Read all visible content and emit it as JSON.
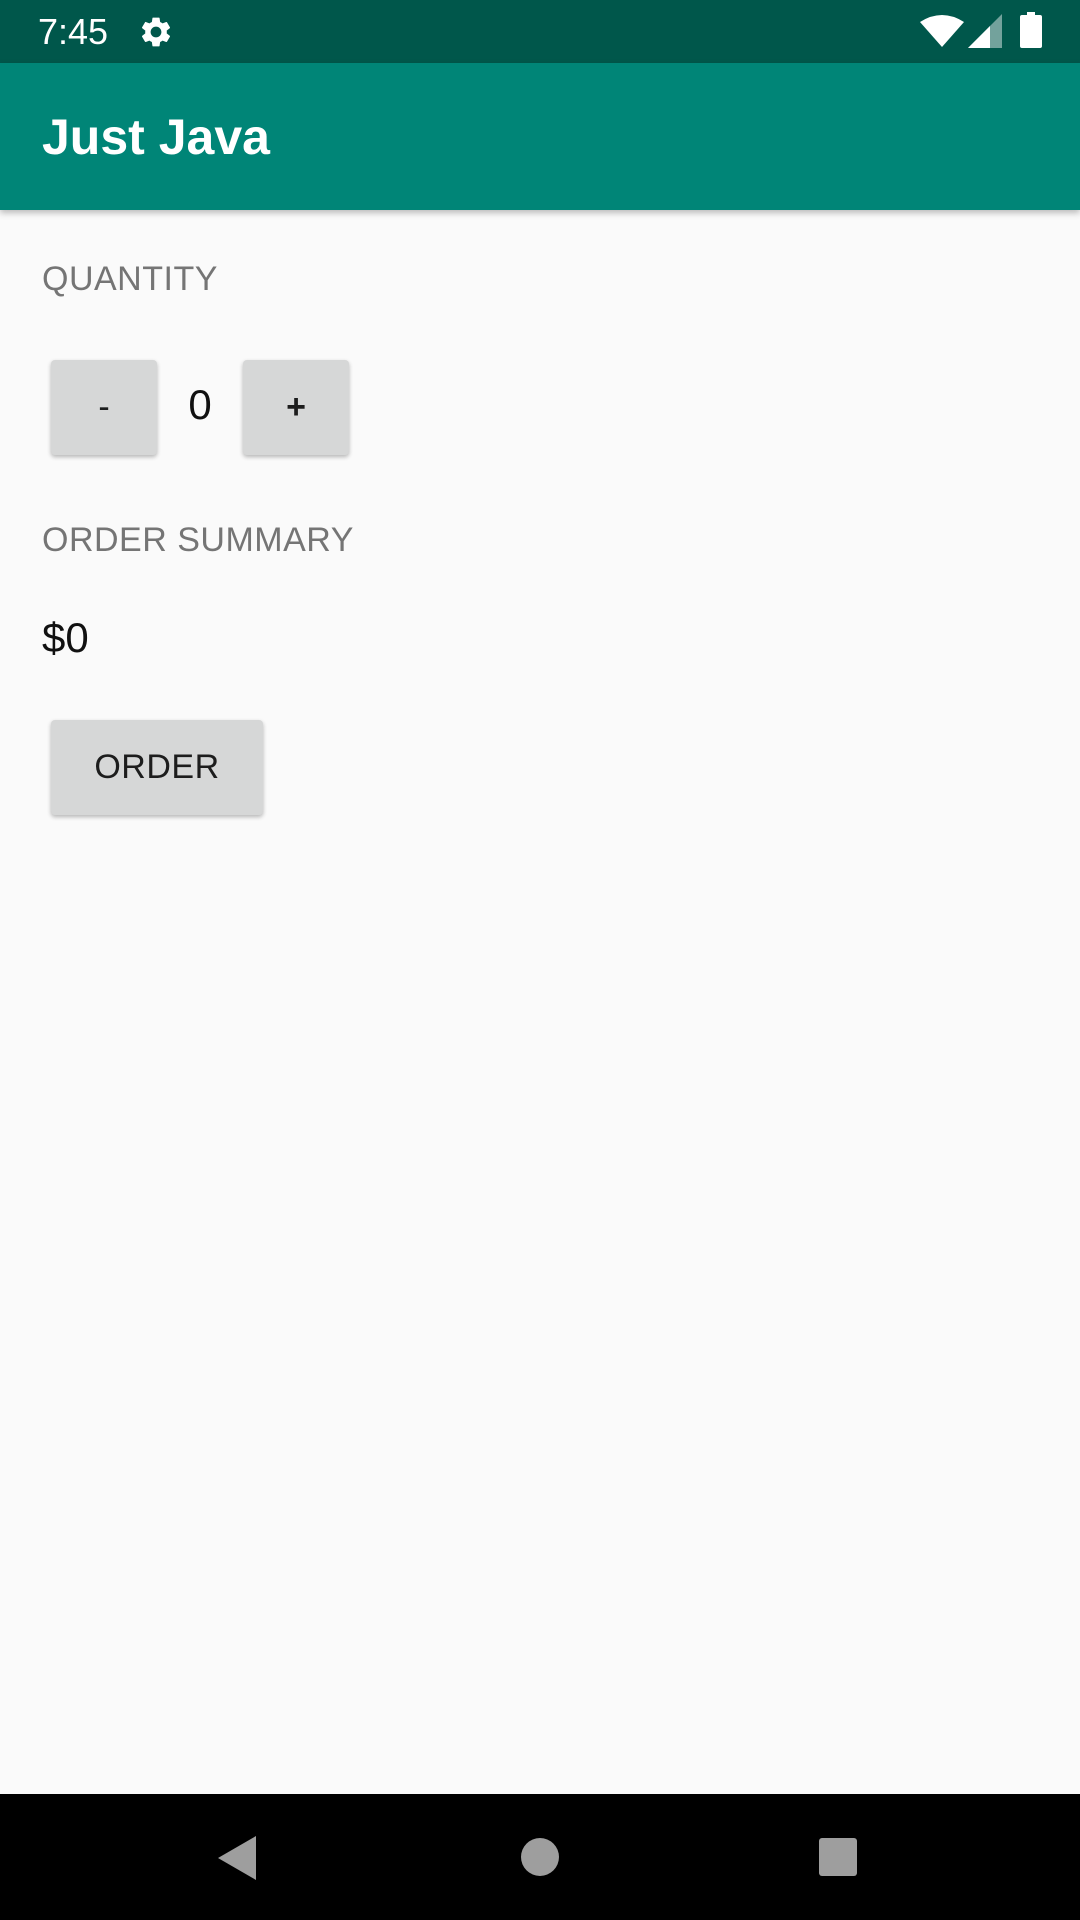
{
  "status_bar": {
    "time": "7:45",
    "icons": [
      "gear-icon",
      "wifi-icon",
      "cell-signal-icon",
      "battery-icon"
    ],
    "background": "#00574b"
  },
  "app_bar": {
    "title": "Just Java",
    "background": "#008577"
  },
  "main": {
    "quantity_label": "QUANTITY",
    "decrement_label": "-",
    "quantity_value": "0",
    "increment_label": "+",
    "summary_label": "ORDER SUMMARY",
    "price": "$0",
    "order_label": "ORDER"
  },
  "nav_bar": {
    "icons": [
      "back-icon",
      "home-icon",
      "recents-icon"
    ]
  },
  "colors": {
    "accent": "#008577",
    "button": "#d6d7d7",
    "label_gray": "#757575",
    "background": "#fafafa"
  }
}
